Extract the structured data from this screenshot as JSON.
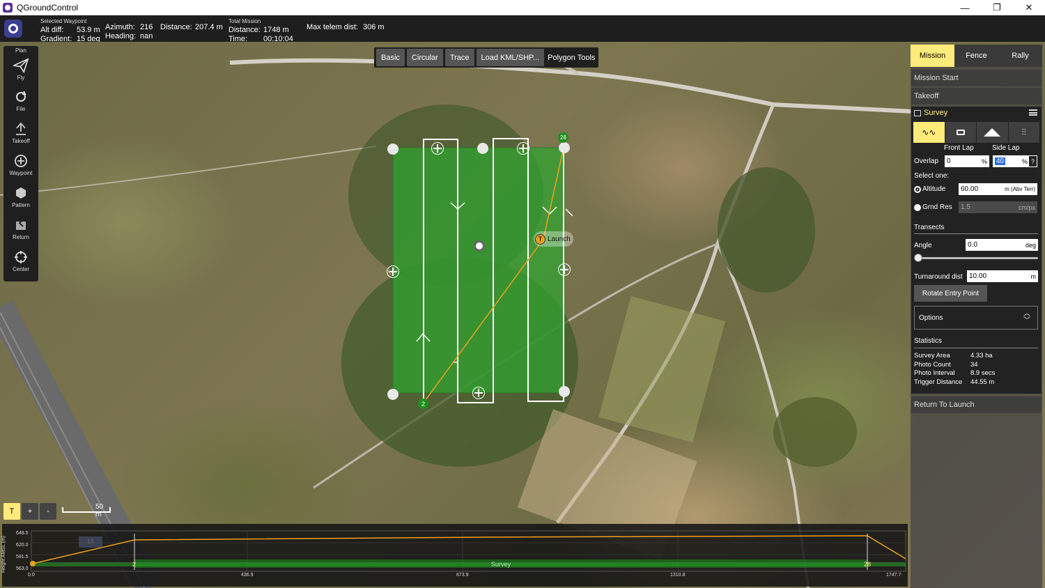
{
  "window": {
    "title": "QGroundControl",
    "minimize": "—",
    "maximize": "❐",
    "close": "✕"
  },
  "telemetry": {
    "selected_caption": "Selected Waypoint",
    "alt_diff_label": "Alt diff:",
    "alt_diff_value": "53.9 m",
    "gradient_label": "Gradient:",
    "gradient_value": "15 deg",
    "azimuth_label": "Azimuth:",
    "azimuth_value": "216",
    "heading_label": "Heading:",
    "heading_value": "nan",
    "distance_label": "Distance:",
    "distance_value": "207.4 m",
    "total_caption": "Total Mission",
    "total_distance_label": "Distance:",
    "total_distance_value": "1748 m",
    "time_label": "Time:",
    "time_value": "00:10:04",
    "max_telem_label": "Max telem dist:",
    "max_telem_value": "306 m"
  },
  "toolstrip": {
    "plan_label": "Plan",
    "items": [
      {
        "label": "Fly",
        "icon": "paper-plane-icon"
      },
      {
        "label": "File",
        "icon": "sync-icon"
      },
      {
        "label": "Takeoff",
        "icon": "takeoff-icon"
      },
      {
        "label": "Waypoint",
        "icon": "plus-circle-icon"
      },
      {
        "label": "Pattern",
        "icon": "pattern-icon"
      },
      {
        "label": "Return",
        "icon": "return-icon"
      },
      {
        "label": "Center",
        "icon": "crosshair-icon"
      }
    ]
  },
  "polygon_tools": {
    "basic": "Basic",
    "circular": "Circular",
    "trace": "Trace",
    "load": "Load KML/SHP...",
    "label": "Polygon Tools"
  },
  "map": {
    "launch_label": "Launch",
    "launch_marker": "T",
    "wp_start": "2",
    "wp_end": "28",
    "scale_label": "50 m",
    "zoom": {
      "t": "T",
      "plus": "+",
      "minus": "-"
    }
  },
  "panel": {
    "tabs": {
      "mission": "Mission",
      "fence": "Fence",
      "rally": "Rally"
    },
    "mission_start": "Mission Start",
    "takeoff": "Takeoff",
    "survey_title": "Survey",
    "front_lap": "Front Lap",
    "side_lap": "Side Lap",
    "overlap_label": "Overlap",
    "overlap_front": "0",
    "overlap_side": "40",
    "percent": "%",
    "help": "?",
    "select_one": "Select one:",
    "altitude_label": "Altitude",
    "altitude_value": "60.00",
    "altitude_unit": "m (Abv Terr)",
    "grnd_res_label": "Grnd Res",
    "grnd_res_value": "1.5",
    "grnd_res_unit": "cm/px",
    "transects": "Transects",
    "angle_label": "Angle",
    "angle_value": "0.0",
    "angle_unit": "deg",
    "turnaround_label": "Turnaround dist",
    "turnaround_value": "10.00",
    "turnaround_unit": "m",
    "rotate_btn": "Rotate Entry Point",
    "options": "Options",
    "statistics": "Statistics",
    "stats": [
      {
        "label": "Survey Area",
        "value": "4.33 ha"
      },
      {
        "label": "Photo Count",
        "value": "34"
      },
      {
        "label": "Photo Interval",
        "value": "8.9 secs"
      },
      {
        "label": "Trigger Distance",
        "value": "44.55 m"
      }
    ],
    "rtl": "Return To Launch"
  },
  "elevation": {
    "y_axis_label": "Height AMSL (m)",
    "y_ticks": [
      "648.5",
      "620.0",
      "591.5",
      "563.0"
    ],
    "x_ticks": [
      "0.0",
      "436.9",
      "873.9",
      "1310.8",
      "1747.7"
    ],
    "survey_label": "Survey",
    "wp_start": "2",
    "wp_end": "28",
    "faded_marker": "15"
  },
  "colors": {
    "accent": "#ffeb7a",
    "survey_fill": "#2fa52f",
    "path": "#f0a020"
  }
}
